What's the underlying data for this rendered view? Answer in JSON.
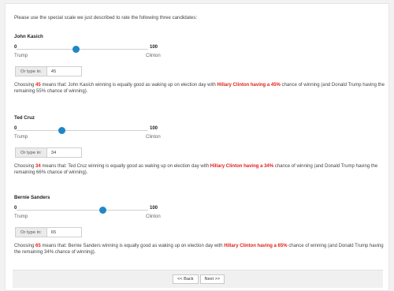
{
  "intro": "Please use the special scale we just described to rate the following three candidates:",
  "scale": {
    "min": "0",
    "max": "100",
    "left_end": "Trump",
    "right_end": "Clinton"
  },
  "type_in_label": "Or type in:",
  "candidates": [
    {
      "name": "John Kasich",
      "value": "45",
      "slider_percent": 45,
      "explain": {
        "pre": "Choosing ",
        "mid": " means that: John Kasich winning is equally good as waking up on election day with ",
        "hilite": "Hillary Clinton having a 45%",
        "post": " chance of winning (and Donald Trump having the remaining 55% chance of winning)."
      }
    },
    {
      "name": "Ted Cruz",
      "value": "34",
      "slider_percent": 34,
      "explain": {
        "pre": "Choosing ",
        "mid": " means that: Ted Cruz winning is equally good as waking up on election day with ",
        "hilite": "Hillary Clinton having a 34%",
        "post": " chance of winning (and Donald Trump having the remaining 66% chance of winning)."
      }
    },
    {
      "name": "Bernie Sanders",
      "value": "65",
      "slider_percent": 65,
      "explain": {
        "pre": "Choosing ",
        "mid": " means that: Bernie Sanders winning is equally good as waking up on election day with ",
        "hilite": "Hillary Clinton having a 65%",
        "post": " chance of winning (and Donald Trump having the remaining 34% chance of winning)."
      }
    }
  ],
  "nav": {
    "back": "<< Back",
    "next": "Next >>"
  },
  "colors": {
    "accent": "#1f87c7",
    "highlight": "#e0201b"
  }
}
